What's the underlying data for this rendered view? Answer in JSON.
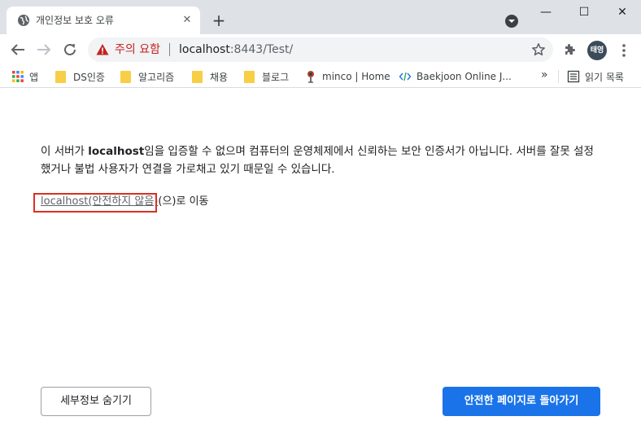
{
  "tab": {
    "title": "개인정보 보호 오류",
    "favicon": "globe-icon",
    "close_label": "✕",
    "new_tab_label": "+"
  },
  "window": {
    "minimize": "—",
    "maximize": "☐",
    "close": "✕"
  },
  "omnibox": {
    "warning_text": "주의 요함",
    "url_host": "localhost",
    "url_rest": ":8443/Test/",
    "warning_color": "#c5221f"
  },
  "profile": {
    "avatar_label": "태영"
  },
  "bookmarks": {
    "items": [
      {
        "label": "앱",
        "icon": "apps-grid-icon"
      },
      {
        "label": "DS인증",
        "icon": "folder-icon"
      },
      {
        "label": "알고리즘",
        "icon": "folder-icon"
      },
      {
        "label": "채용",
        "icon": "folder-icon"
      },
      {
        "label": "블로그",
        "icon": "folder-icon"
      },
      {
        "label": "minco | Home",
        "icon": "site-icon"
      },
      {
        "label": "Baekjoon Online J...",
        "icon": "code-icon"
      }
    ],
    "more_label": "»",
    "reading_list_label": "읽기 목록"
  },
  "interstitial": {
    "description_pre": "이 서버가 ",
    "description_bold": "localhost",
    "description_post": "임을 입증할 수 없으며 컴퓨터의 운영체제에서 신뢰하는 보안 인증서가 아닙니다. 서버를 잘못 설정했거나 불법 사용자가 연결을 가로채고 있기 때문일 수 있습니다.",
    "proceed_link": "localhost(안전하지 않음)",
    "proceed_suffix": "(으)로 이동",
    "details_button": "세부정보 숨기기",
    "back_button": "안전한 페이지로 돌아가기",
    "accent_color": "#1a73e8"
  }
}
